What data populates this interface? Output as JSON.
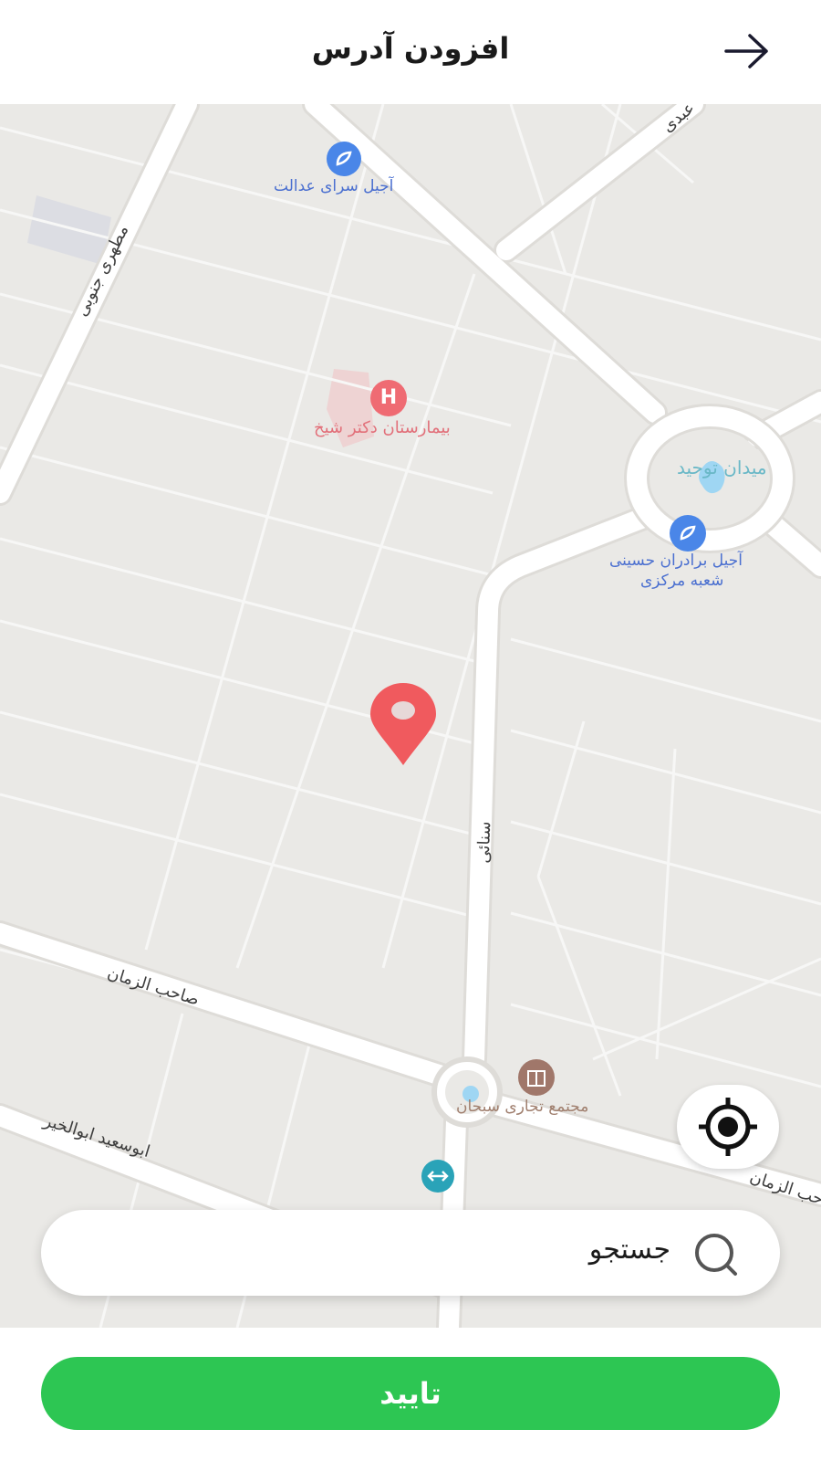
{
  "header": {
    "title": "افزودن آدرس",
    "back_icon": "arrow-right-icon"
  },
  "map": {
    "pois": [
      {
        "label": "آجیل سرای عدالت",
        "icon": "shop-icon"
      },
      {
        "label": "بیمارستان دکتر شیخ",
        "icon": "hospital-icon"
      },
      {
        "label": "میدان توحید",
        "icon": "square-icon"
      },
      {
        "label_line1": "آجیل برادران حسینی",
        "label_line2": "شعبه مرکزی",
        "icon": "shop-icon"
      },
      {
        "label": "مجتمع تجاری سبحان",
        "icon": "mall-icon"
      }
    ],
    "streets": [
      "مطهری جنوبی",
      "صاحب الزمان",
      "سنائی",
      "ابوسعید ابوالخیر",
      "صاحب الزمان",
      "عبدی"
    ],
    "marker_icon": "map-pin-icon",
    "colors": {
      "map_bg": "#eae9e6",
      "road": "#ffffff",
      "pin": "#f05a5e",
      "poi_blue": "#4a86e8"
    }
  },
  "locate_icon": "locate-icon",
  "search": {
    "placeholder": "جستجو",
    "icon": "search-icon"
  },
  "confirm_label": "تایید",
  "colors": {
    "accent": "#2dc653"
  }
}
